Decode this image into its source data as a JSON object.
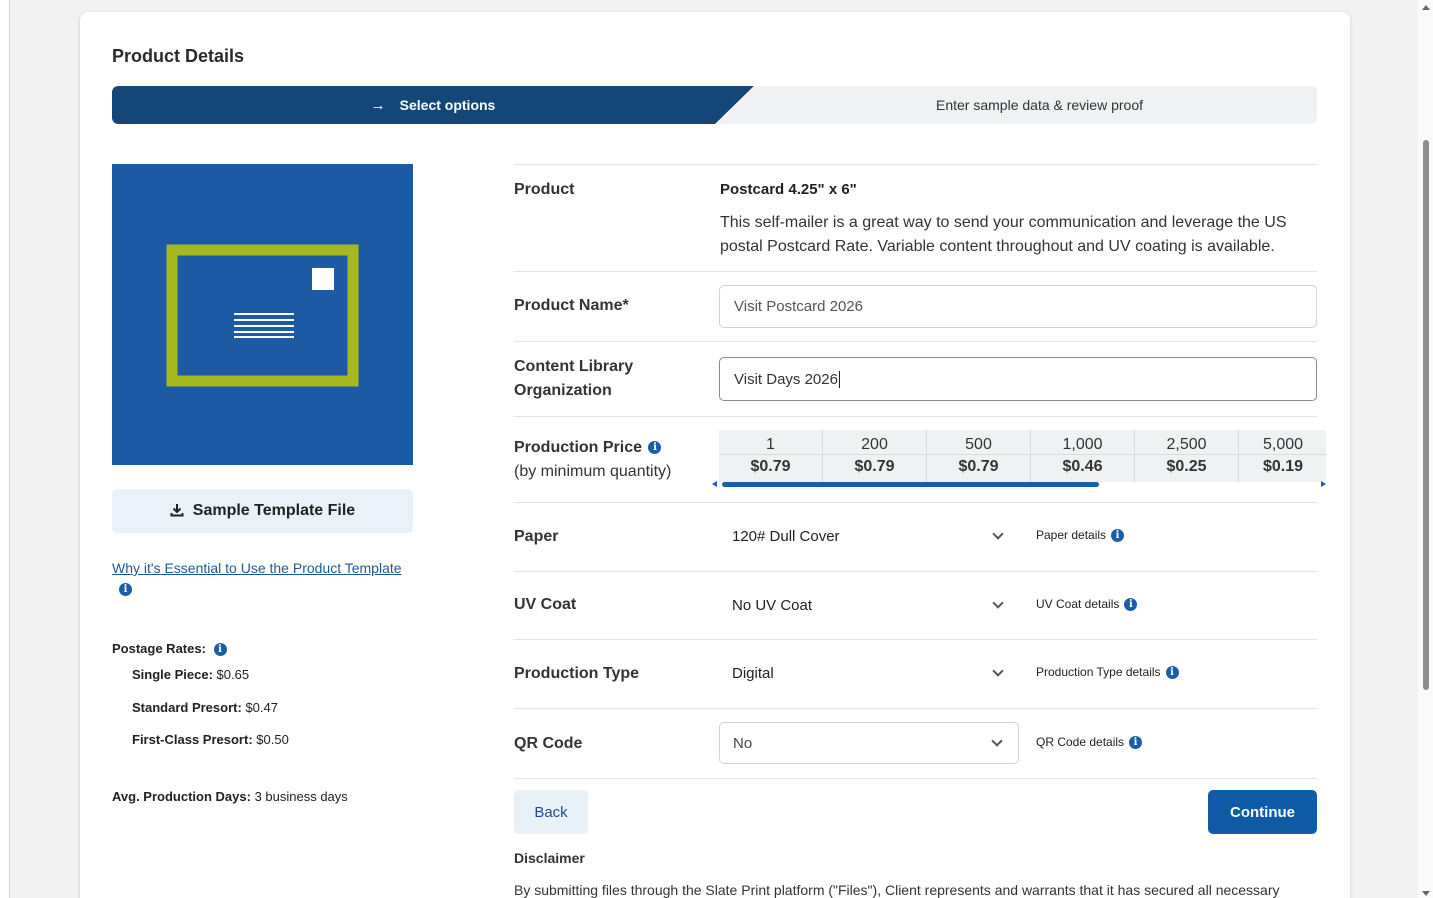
{
  "page": {
    "title": "Product Details"
  },
  "stepper": {
    "active_label": "Select options",
    "next_label": "Enter sample data & review proof"
  },
  "left": {
    "sample_button": "Sample Template File",
    "why_link": "Why it's Essential to Use the Product Template",
    "postage_title": "Postage Rates:",
    "postage": [
      {
        "label": "Single Piece:",
        "value": "$0.65"
      },
      {
        "label": "Standard Presort:",
        "value": "$0.47"
      },
      {
        "label": "First-Class Presort:",
        "value": "$0.50"
      }
    ],
    "avg_days_label": "Avg. Production Days:",
    "avg_days_value": "3 business days"
  },
  "form": {
    "product_label": "Product",
    "product_value": "Postcard 4.25\" x 6\"",
    "product_desc": "This self-mailer is a great way to send your communication and leverage the US postal Postcard Rate. Variable content throughout and UV coating is available.",
    "product_name_label": "Product Name*",
    "product_name_value": "Visit Postcard 2026",
    "content_library_label_1": "Content Library",
    "content_library_label_2": "Organization",
    "content_library_value": "Visit Days 2026",
    "production_price_label": "Production Price",
    "production_price_sub": "(by minimum quantity)",
    "price_table": [
      {
        "qty": "1",
        "price": "$0.79"
      },
      {
        "qty": "200",
        "price": "$0.79"
      },
      {
        "qty": "500",
        "price": "$0.79"
      },
      {
        "qty": "1,000",
        "price": "$0.46"
      },
      {
        "qty": "2,500",
        "price": "$0.25"
      },
      {
        "qty": "5,000",
        "price": "$0.19"
      }
    ],
    "paper_label": "Paper",
    "paper_value": "120# Dull Cover",
    "paper_details": "Paper details",
    "uv_label": "UV Coat",
    "uv_value": "No UV Coat",
    "uv_details": "UV Coat details",
    "ptype_label": "Production Type",
    "ptype_value": "Digital",
    "ptype_details": "Production Type details",
    "qr_label": "QR Code",
    "qr_value": "No",
    "qr_details": "QR Code details"
  },
  "actions": {
    "back": "Back",
    "continue": "Continue"
  },
  "disclaimer": {
    "title": "Disclaimer",
    "text": "By submitting files through the Slate Print platform (\"Files\"), Client represents and warrants that it has secured all necessary"
  },
  "colors": {
    "primary": "#14467a",
    "accent": "#0f5ba6",
    "preview_bg": "#1c5aa3",
    "preview_frame": "#a8b820"
  },
  "icons": {
    "step_arrow": "arrow-right-icon",
    "download": "download-icon",
    "info": "info-icon",
    "chevron": "chevron-down-icon"
  }
}
